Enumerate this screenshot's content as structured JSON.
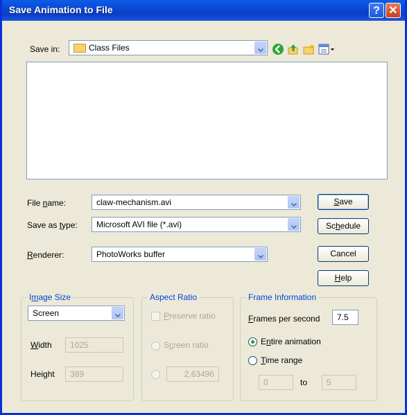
{
  "window": {
    "title": "Save Animation to File"
  },
  "save_in": {
    "label": "Save in:",
    "value": "Class Files"
  },
  "file_name": {
    "label": "File name:",
    "value": "claw-mechanism.avi"
  },
  "save_as_type": {
    "label": "Save as type:",
    "value": "Microsoft AVI file (*.avi)"
  },
  "renderer": {
    "label": "Renderer:",
    "value": "PhotoWorks buffer"
  },
  "buttons": {
    "save": "Save",
    "schedule": "Schedule",
    "cancel": "Cancel",
    "help": "Help"
  },
  "image_size": {
    "title": "Image Size",
    "mode": "Screen",
    "width_label": "Width",
    "width": "1025",
    "height_label": "Height",
    "height": "389"
  },
  "aspect_ratio": {
    "title": "Aspect Ratio",
    "preserve_label": "Preserve ratio",
    "screen_ratio_label": "Screen ratio",
    "custom_value": "2.63496"
  },
  "frame_info": {
    "title": "Frame Information",
    "fps_label": "Frames per second",
    "fps": "7.5",
    "entire_label": "Entire animation",
    "range_label": "Time range",
    "range_from": "0",
    "range_to_label": "to",
    "range_to": "5",
    "selected": "entire"
  },
  "colors": {
    "title_bar": "#0a49d6",
    "group_title": "#0046d5",
    "disabled_text": "#aca899",
    "dialog_bg": "#ece9d8"
  }
}
